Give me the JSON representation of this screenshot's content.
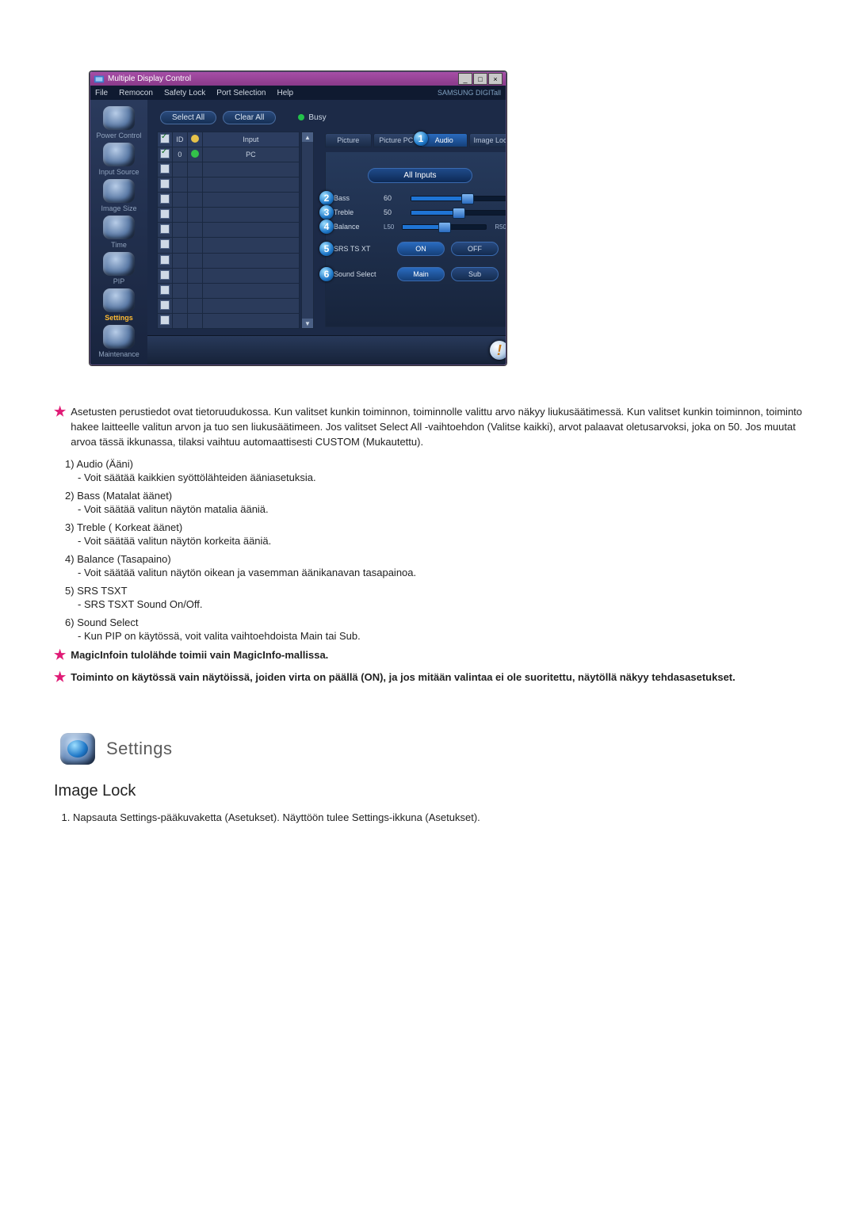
{
  "app": {
    "title": "Multiple Display Control",
    "menu": [
      "File",
      "Remocon",
      "Safety Lock",
      "Port Selection",
      "Help"
    ],
    "brand": "SAMSUNG DIGITall",
    "sidebar": [
      {
        "label": "Power Control"
      },
      {
        "label": "Input Source"
      },
      {
        "label": "Image Size"
      },
      {
        "label": "Time"
      },
      {
        "label": "PIP"
      },
      {
        "label": "Settings",
        "selected": true
      },
      {
        "label": "Maintenance"
      }
    ],
    "toolbar": {
      "select_all": "Select All",
      "clear_all": "Clear All",
      "busy": "Busy"
    },
    "grid": {
      "headers": {
        "chk": "",
        "id": "ID",
        "stat": "",
        "input": "Input"
      },
      "rows": [
        {
          "checked": true,
          "id": "0",
          "status": "ok",
          "input": "PC"
        }
      ],
      "blank_rows": 11
    },
    "tabs": [
      "Picture",
      "Picture PC",
      "Audio",
      "Image Lock"
    ],
    "tab_selected": "Audio",
    "panel": {
      "all_inputs": "All Inputs",
      "sliders": [
        {
          "callout": "2",
          "label": "Bass",
          "value": "60",
          "pct": 60
        },
        {
          "callout": "3",
          "label": "Treble",
          "value": "50",
          "pct": 50
        }
      ],
      "balance": {
        "callout": "4",
        "label": "Balance",
        "left": "L50",
        "right": "R50",
        "pct": 50
      },
      "switches": [
        {
          "callout": "5",
          "label": "SRS TS XT",
          "on": "ON",
          "off": "OFF"
        },
        {
          "callout": "6",
          "label": "Sound Select",
          "on": "Main",
          "off": "Sub"
        }
      ],
      "callout_tab": "1"
    }
  },
  "doc": {
    "intro": "Asetusten perustiedot ovat tietoruudukossa. Kun valitset kunkin toiminnon, toiminnolle valittu arvo näkyy liukusäätimessä. Kun valitset kunkin toiminnon, toiminto hakee laitteelle valitun arvon ja tuo sen liukusäätimeen. Jos valitset Select All -vaihtoehdon (Valitse kaikki), arvot palaavat oletusarvoksi, joka on 50. Jos muutat arvoa tässä ikkunassa, tilaksi vaihtuu automaattisesti CUSTOM (Mukautettu).",
    "items": [
      {
        "n": "1)",
        "t": "Audio (Ääni)",
        "s": "- Voit säätää kaikkien syöttölähteiden ääniasetuksia."
      },
      {
        "n": "2)",
        "t": "Bass (Matalat äänet)",
        "s": "- Voit säätää valitun näytön matalia ääniä."
      },
      {
        "n": "3)",
        "t": "Treble ( Korkeat äänet)",
        "s": "- Voit säätää valitun näytön korkeita ääniä."
      },
      {
        "n": "4)",
        "t": "Balance (Tasapaino)",
        "s": "- Voit säätää valitun näytön oikean ja vasemman äänikanavan tasapainoa."
      },
      {
        "n": "5)",
        "t": "SRS TSXT",
        "s": "- SRS TSXT Sound On/Off."
      },
      {
        "n": "6)",
        "t": "Sound Select",
        "s": "- Kun PIP on käytössä, voit valita vaihtoehdoista Main tai Sub."
      }
    ],
    "note2": "MagicInfoin tulolähde toimii vain MagicInfo-mallissa.",
    "note3": "Toiminto on käytössä vain näytöissä, joiden virta on päällä (ON), ja jos mitään valintaa ei ole suoritettu, näytöllä näkyy tehdasasetukset.",
    "section": "Settings",
    "h3": "Image Lock",
    "step1": "Napsauta Settings-pääkuvaketta (Asetukset). Näyttöön tulee Settings-ikkuna (Asetukset)."
  }
}
